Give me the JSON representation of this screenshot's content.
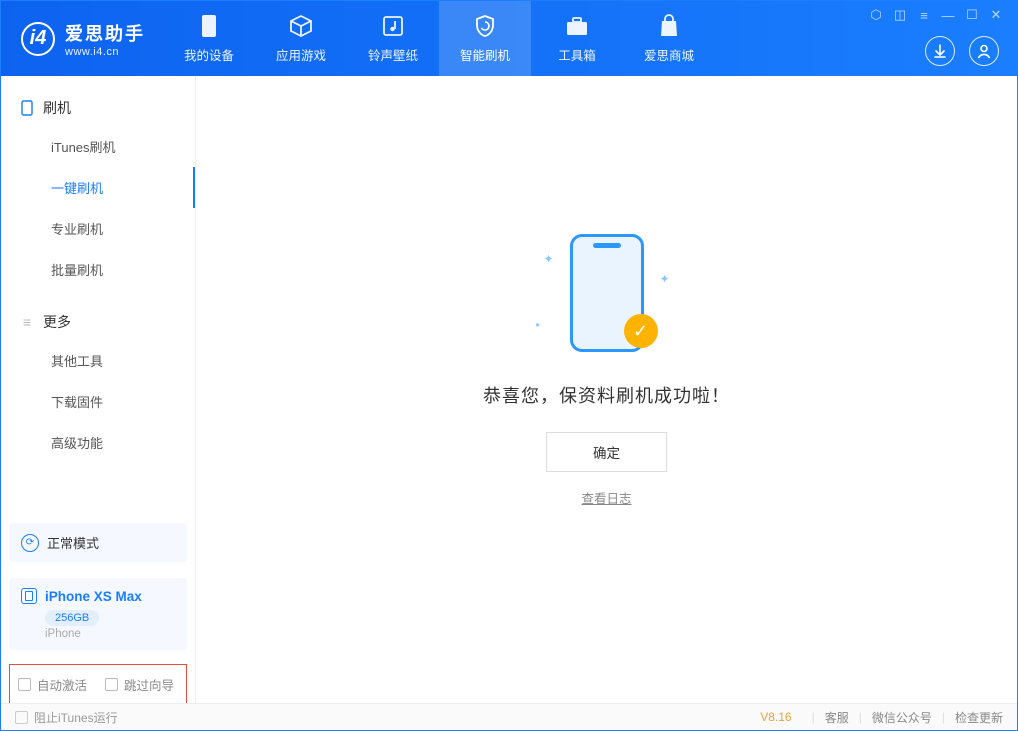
{
  "app": {
    "name": "爱思助手",
    "url": "www.i4.cn"
  },
  "nav": {
    "tabs": [
      {
        "label": "我的设备"
      },
      {
        "label": "应用游戏"
      },
      {
        "label": "铃声壁纸"
      },
      {
        "label": "智能刷机"
      },
      {
        "label": "工具箱"
      },
      {
        "label": "爱思商城"
      }
    ]
  },
  "sidebar": {
    "group1": {
      "title": "刷机",
      "items": [
        "iTunes刷机",
        "一键刷机",
        "专业刷机",
        "批量刷机"
      ]
    },
    "group2": {
      "title": "更多",
      "items": [
        "其他工具",
        "下载固件",
        "高级功能"
      ]
    },
    "mode": "正常模式",
    "device": {
      "name": "iPhone XS Max",
      "storage": "256GB",
      "type": "iPhone"
    },
    "checkbox1": "自动激活",
    "checkbox2": "跳过向导"
  },
  "main": {
    "success": "恭喜您，保资料刷机成功啦！",
    "ok": "确定",
    "log": "查看日志"
  },
  "footer": {
    "blockItunes": "阻止iTunes运行",
    "version": "V8.16",
    "links": [
      "客服",
      "微信公众号",
      "检查更新"
    ]
  }
}
